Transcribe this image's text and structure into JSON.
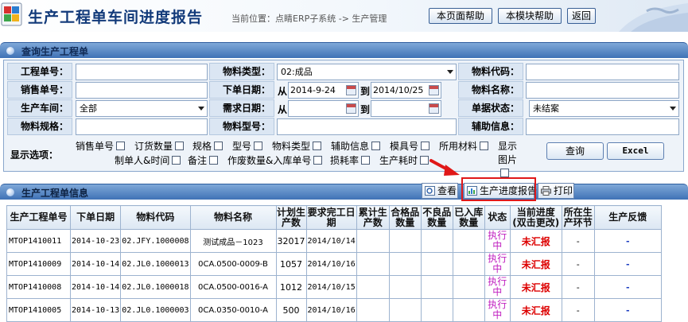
{
  "header": {
    "title": "生产工程单车间进度报告",
    "location": "当前位置：点睛ERP子系统 -> 生产管理",
    "buttons": {
      "page_help": "本页面帮助",
      "module_help": "本模块帮助",
      "back": "返回"
    }
  },
  "query_panel": {
    "title": "查询生产工程单",
    "labels": {
      "work_order_no": "工程单号：",
      "material_type": "物料类型：",
      "material_code": "物料代码：",
      "sales_order_no": "销售单号：",
      "order_date": "下单日期：",
      "material_name": "物料名称：",
      "workshop": "生产车间：",
      "required_date": "需求日期：",
      "doc_status": "单据状态：",
      "material_spec": "物料规格：",
      "material_model": "物料型号：",
      "aux_info": "辅助信息："
    },
    "values": {
      "material_type": "02:成品",
      "workshop": "全部",
      "doc_status": "未结案",
      "order_date_from": "2014-9-24",
      "order_date_to": "2014/10/25",
      "from_label": "从",
      "to_label": "到"
    },
    "display_options_label": "显示选项：",
    "display_options": [
      "销售单号",
      "订货数量",
      "规格",
      "型号",
      "物料类型",
      "辅助信息",
      "模具号",
      "所用材料",
      "显示图片",
      "制单人&时间",
      "备注",
      "作废数量&入库单号",
      "损耗率",
      "生产耗时"
    ],
    "buttons": {
      "query": "查询",
      "excel": "Excel"
    }
  },
  "info_panel": {
    "title": "生产工程单信息",
    "buttons": {
      "view": "查看",
      "progress_report": "生产进度报告",
      "print": "打印"
    }
  },
  "table": {
    "headers": [
      "生产工程单号",
      "下单日期",
      "物料代码",
      "物料名称",
      "计划生产数",
      "要求完工日期",
      "累计生产数",
      "合格品数量",
      "不良品数量",
      "已入库数量",
      "状态",
      "当前进度(双击更改)",
      "所在生产环节",
      "生产反馈"
    ],
    "rows": [
      [
        "MTOP1410011",
        "2014-10-23",
        "02.JFY.1000008",
        "测试成品－1023",
        "32017",
        "2014/10/14",
        "",
        "",
        "",
        "",
        "执行中",
        "未汇报",
        "-",
        "-"
      ],
      [
        "MTOP1410009",
        "2014-10-14",
        "02.JL0.1000013",
        "0CA.0500-0009-B",
        "1057",
        "2014/10/16",
        "",
        "",
        "",
        "",
        "执行中",
        "未汇报",
        "-",
        "-"
      ],
      [
        "MTOP1410008",
        "2014-10-14",
        "02.JL0.1000018",
        "0CA.0500-0016-A",
        "1012",
        "2014/10/15",
        "",
        "",
        "",
        "",
        "执行中",
        "未汇报",
        "-",
        "-"
      ],
      [
        "MTOP1410005",
        "2014-10-13",
        "02.JL0.1000003",
        "0CA.0350-0010-A",
        "500",
        "2014/10/16",
        "",
        "",
        "",
        "",
        "执行中",
        "未汇报",
        "-",
        "-"
      ]
    ]
  }
}
